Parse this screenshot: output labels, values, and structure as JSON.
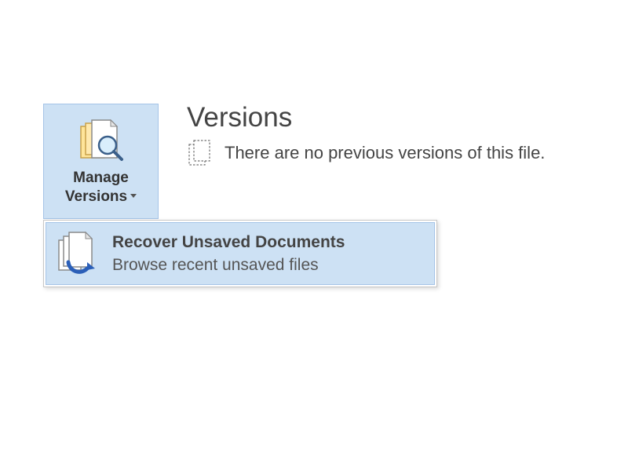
{
  "manageVersions": {
    "line1": "Manage",
    "line2": "Versions"
  },
  "section": {
    "title": "Versions",
    "emptyMessage": "There are no previous versions of this file."
  },
  "menu": {
    "recover": {
      "title": "Recover Unsaved Documents",
      "description": "Browse recent unsaved files"
    }
  }
}
